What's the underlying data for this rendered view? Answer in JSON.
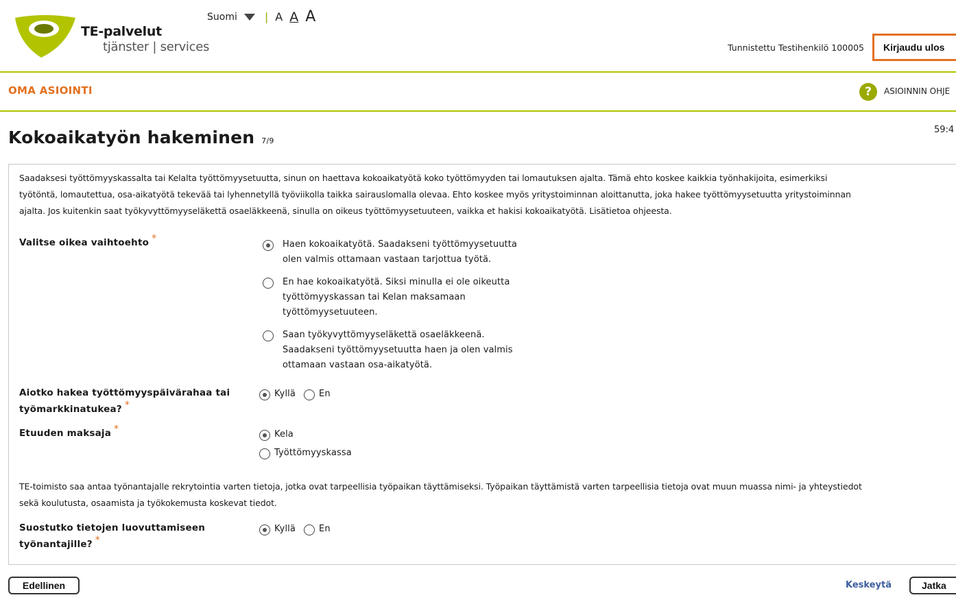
{
  "header": {
    "brand_name": "TE-palvelut",
    "brand_sub": "tjänster | services",
    "language": "Suomi",
    "font_sizes": [
      "A",
      "A",
      "A"
    ],
    "user_info": "Tunnistettu Testihenkilö 100005",
    "logout_label": "Kirjaudu ulos"
  },
  "nav": {
    "title": "OMA ASIOINTI",
    "help_label": "ASIOINNIN OHJE"
  },
  "page": {
    "title": "Kokoaikatyön hakeminen",
    "step": "7/9",
    "timer": "59:4"
  },
  "form": {
    "intro_lines": [
      "Saadaksesi työttömyyskassalta tai Kelalta työttömyysetuutta, sinun on haettava kokoaikatyötä koko työttömyyden tai lomautuksen ajalta. Tämä ehto koskee kaikkia työnhakijoita, esimerkiksi",
      "työtöntä, lomautettua, osa-aikatyötä tekevää tai lyhennetyllä työviikolla taikka sairauslomalla olevaa. Ehto koskee myös yritystoiminnan aloittanutta, joka hakee työttömyysetuutta yritystoiminnan",
      "ajalta. Jos kuitenkin saat työkyvyttömyyseläkettä osaeläkkeenä, sinulla on oikeus työttömyysetuuteen, vaikka et hakisi kokoaikatyötä. Lisätietoa ohjeesta."
    ],
    "q1": {
      "label": "Valitse oikea vaihtoehto",
      "options": [
        {
          "lines": [
            "Haen kokoaikatyötä. Saadakseni työttömyysetuutta",
            "olen valmis ottamaan vastaan tarjottua työtä."
          ],
          "selected": true
        },
        {
          "lines": [
            "En hae kokoaikatyötä. Siksi minulla ei ole oikeutta",
            "työttömyyskassan tai Kelan maksamaan",
            "työttömyysetuuteen."
          ],
          "selected": false
        },
        {
          "lines": [
            "Saan työkyvyttömyyseläkettä osaeläkkeenä.",
            "Saadakseni työttömyysetuutta haen ja olen valmis",
            "ottamaan vastaan osa-aikatyötä."
          ],
          "selected": false
        }
      ]
    },
    "q2": {
      "label_lines": [
        "Aiotko hakea työttömyyspäivärahaa tai",
        "työmarkkinatukea?"
      ],
      "opt_yes": "Kyllä",
      "opt_no": "En",
      "selected": "Kyllä"
    },
    "q3": {
      "label": "Etuuden maksaja",
      "opt_kela": "Kela",
      "opt_kassa": "Työttömyyskassa",
      "selected": "Kela"
    },
    "info_lines": [
      "TE-toimisto saa antaa työnantajalle rekrytointia varten tietoja, jotka ovat tarpeellisia työpaikan täyttämiseksi. Työpaikan täyttämistä varten tarpeellisia tietoja ovat muun muassa nimi- ja yhteystiedot",
      "sekä koulutusta, osaamista ja työkokemusta koskevat tiedot."
    ],
    "q4": {
      "label_lines": [
        "Suostutko tietojen luovuttamiseen",
        "työnantajille?"
      ],
      "opt_yes": "Kyllä",
      "opt_no": "En",
      "selected": "Kyllä"
    },
    "required_mark": "*"
  },
  "footer": {
    "prev_label": "Edellinen",
    "cancel_label": "Keskeytä",
    "next_label": "Jatka"
  },
  "colors": {
    "accent_orange": "#e3701f",
    "brand_green": "#9aaa00",
    "link_blue": "#3d5e9e"
  }
}
